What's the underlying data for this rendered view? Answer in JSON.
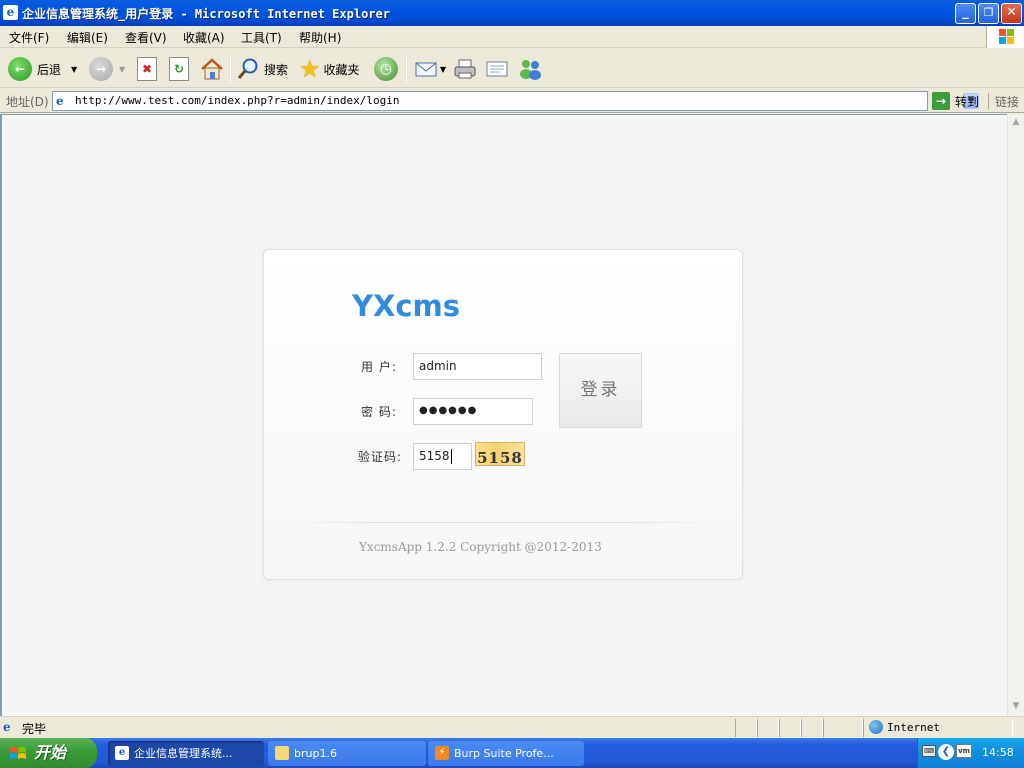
{
  "window": {
    "title": "企业信息管理系统_用户登录 - Microsoft Internet Explorer",
    "controls": [
      "_",
      "❐",
      "✕"
    ]
  },
  "menu": [
    "文件(F)",
    "编辑(E)",
    "查看(V)",
    "收藏(A)",
    "工具(T)",
    "帮助(H)"
  ],
  "toolbar": {
    "back_label": "后退",
    "search_label": "搜索",
    "favorites_label": "收藏夹"
  },
  "address": {
    "label": "地址(D)",
    "url": "http://www.test.com/index.php?r=admin/index/login",
    "go_label": "转到",
    "links_label": "链接"
  },
  "login": {
    "logo": "YXcms",
    "username_label": "用  户:",
    "username_value": "admin",
    "password_label": "密  码:",
    "password_value": "●●●●●●",
    "captcha_label": "验证码:",
    "captcha_value": "5158",
    "captcha_image_text": "5158",
    "submit_label": "登录",
    "copyright": "YxcmsApp 1.2.2 Copyright @2012-2013"
  },
  "status": {
    "text": "完毕",
    "zone": "Internet"
  },
  "taskbar": {
    "start_label": "开始",
    "tasks": [
      {
        "label": "企业信息管理系统..."
      },
      {
        "label": "brup1.6"
      },
      {
        "label": "Burp Suite Profe..."
      }
    ],
    "clock": "14:58"
  },
  "colors": {
    "logo": "#2F8CE0",
    "titlebar": "#0054E3",
    "start": "#3C9D3A"
  }
}
